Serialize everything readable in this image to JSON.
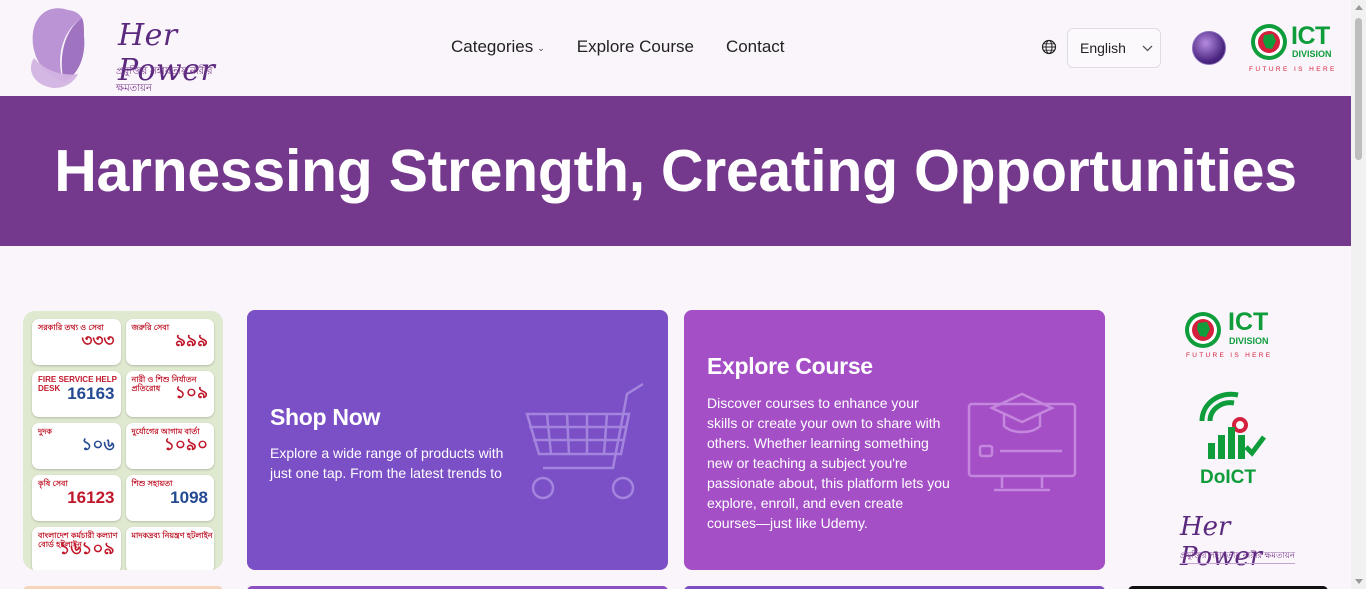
{
  "brand": {
    "name": "Her Power",
    "tagline": "প্রযুক্তির সহায়তায় নারীর ক্ষমতায়ন"
  },
  "nav": {
    "categories": "Categories",
    "explore": "Explore Course",
    "contact": "Contact"
  },
  "language": {
    "selected": "English"
  },
  "ict": {
    "title": "ICT",
    "division": "DIVISION",
    "future": "FUTURE IS HERE"
  },
  "hero": {
    "title": "Harnessing Strength, Creating Opportunities"
  },
  "hotlines": [
    {
      "label": "সরকারি তথ্য ও সেবা",
      "number": "৩৩৩"
    },
    {
      "label": "জরুরি সেবা",
      "number": "৯৯৯"
    },
    {
      "label": "FIRE SERVICE HELP DESK",
      "number": "16163"
    },
    {
      "label": "নারী ও শিশু নির্যাতন প্রতিরোধ",
      "number": "১০৯"
    },
    {
      "label": "দুদক",
      "number": "১০৬"
    },
    {
      "label": "দুর্যোগের আগাম বার্তা",
      "number": "১০৯০"
    },
    {
      "label": "কৃষি সেবা",
      "number": "16123"
    },
    {
      "label": "শিশু সহায়তা",
      "number": "1098"
    },
    {
      "label": "বাংলাদেশ কর্মচারী কল্যাণ বোর্ড হটলাইন",
      "number": "১৬১০৯"
    },
    {
      "label": "মাদকদ্রব্য নিয়ন্ত্রণ হটলাইন",
      "number": ""
    }
  ],
  "cards": {
    "shop": {
      "title": "Shop Now",
      "desc": "Explore a wide range of products with just one tap. From the latest trends to"
    },
    "explore": {
      "title": "Explore Course",
      "desc": "Discover courses to enhance your skills or create your own to share with others. Whether learning something new or teaching a subject you're passionate about, this platform lets you explore, enroll, and even create courses—just like Udemy."
    }
  },
  "partners": {
    "doict": "DoICT",
    "herpower": "Her Power",
    "herpower_sub": "প্রযুক্তির সহায়তায় নারীর ক্ষমতায়ন"
  },
  "colors": {
    "hero_bg": "#74388d",
    "shop_card": "#7b4fc6",
    "explore_card": "#a54fc7",
    "ict_green": "#0f9d3c",
    "ict_red": "#d4203c"
  }
}
